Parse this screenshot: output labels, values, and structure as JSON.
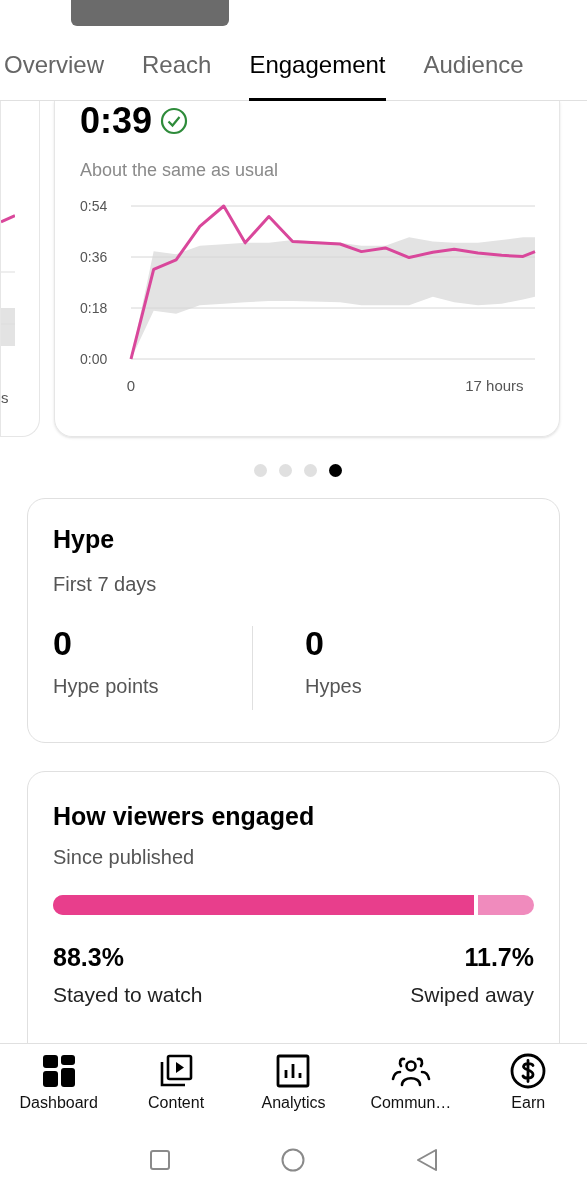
{
  "tabs": [
    {
      "label": "Overview",
      "selected": false
    },
    {
      "label": "Reach",
      "selected": false
    },
    {
      "label": "Engagement",
      "selected": true
    },
    {
      "label": "Audience",
      "selected": false
    }
  ],
  "previous_card": {
    "axis_label": "s"
  },
  "retention_card": {
    "value": "0:39",
    "status": "About the same as usual",
    "chart_data": {
      "type": "line",
      "x": [
        0,
        1.06,
        2.11,
        3.22,
        4.34,
        5.34,
        6.45,
        7.56,
        9.78,
        10.78,
        11.9,
        13.01,
        14.12,
        15.12,
        16.23,
        17.34,
        18.34,
        18.9
      ],
      "xticks": [
        {
          "value": 0,
          "label": "0"
        },
        {
          "value": 17,
          "label": "17 hours"
        }
      ],
      "yticks": [
        {
          "value": 0,
          "label": "0:00"
        },
        {
          "value": 18,
          "label": "0:18"
        },
        {
          "value": 36,
          "label": "0:36"
        },
        {
          "value": 54,
          "label": "0:54"
        }
      ],
      "ylim": [
        0,
        54
      ],
      "xlim": [
        0,
        18.9
      ],
      "series": [
        {
          "color": "#d9479b",
          "values": [
            0,
            31.6,
            35,
            46.8,
            54,
            41,
            50.3,
            41.5,
            40.6,
            37.9,
            39.2,
            35.8,
            37.7,
            38.7,
            37.4,
            36.6,
            36.2,
            37.9
          ]
        },
        {
          "type": "area",
          "color": "#e3e3e3",
          "values": [
            0,
            38,
            37,
            40,
            40.5,
            41,
            41,
            42,
            41,
            40,
            40,
            43,
            41.5,
            41,
            41,
            42,
            43,
            43
          ]
        },
        {
          "type": "area",
          "color": "#ffffff",
          "values": [
            0,
            17,
            16,
            19,
            19.5,
            20,
            20.5,
            20.5,
            20,
            19,
            19,
            19,
            22,
            20,
            19,
            19.5,
            21,
            22
          ]
        }
      ],
      "stacked": false
    }
  },
  "pager": [
    {
      "selected": false
    },
    {
      "selected": false
    },
    {
      "selected": false
    },
    {
      "selected": true
    }
  ],
  "hype_card": {
    "title": "Hype",
    "period": "First 7 days",
    "stats": [
      {
        "value": "0",
        "label": "Hype points"
      },
      {
        "value": "0",
        "label": "Hypes"
      }
    ]
  },
  "engaged_card": {
    "title": "How viewers engaged",
    "period": "Since published",
    "bar": {
      "level": 0.883
    },
    "stats": [
      {
        "value": "88.3%",
        "label": "Stayed to watch"
      },
      {
        "value": "11.7%",
        "label": "Swiped away"
      }
    ]
  },
  "bottom_nav": [
    {
      "kind": "dashboard",
      "label": "Dashboard"
    },
    {
      "kind": "content",
      "label": "Content"
    },
    {
      "kind": "analytics",
      "label": "Analytics"
    },
    {
      "kind": "community",
      "label": "Commun…"
    },
    {
      "kind": "earn",
      "label": "Earn"
    }
  ]
}
